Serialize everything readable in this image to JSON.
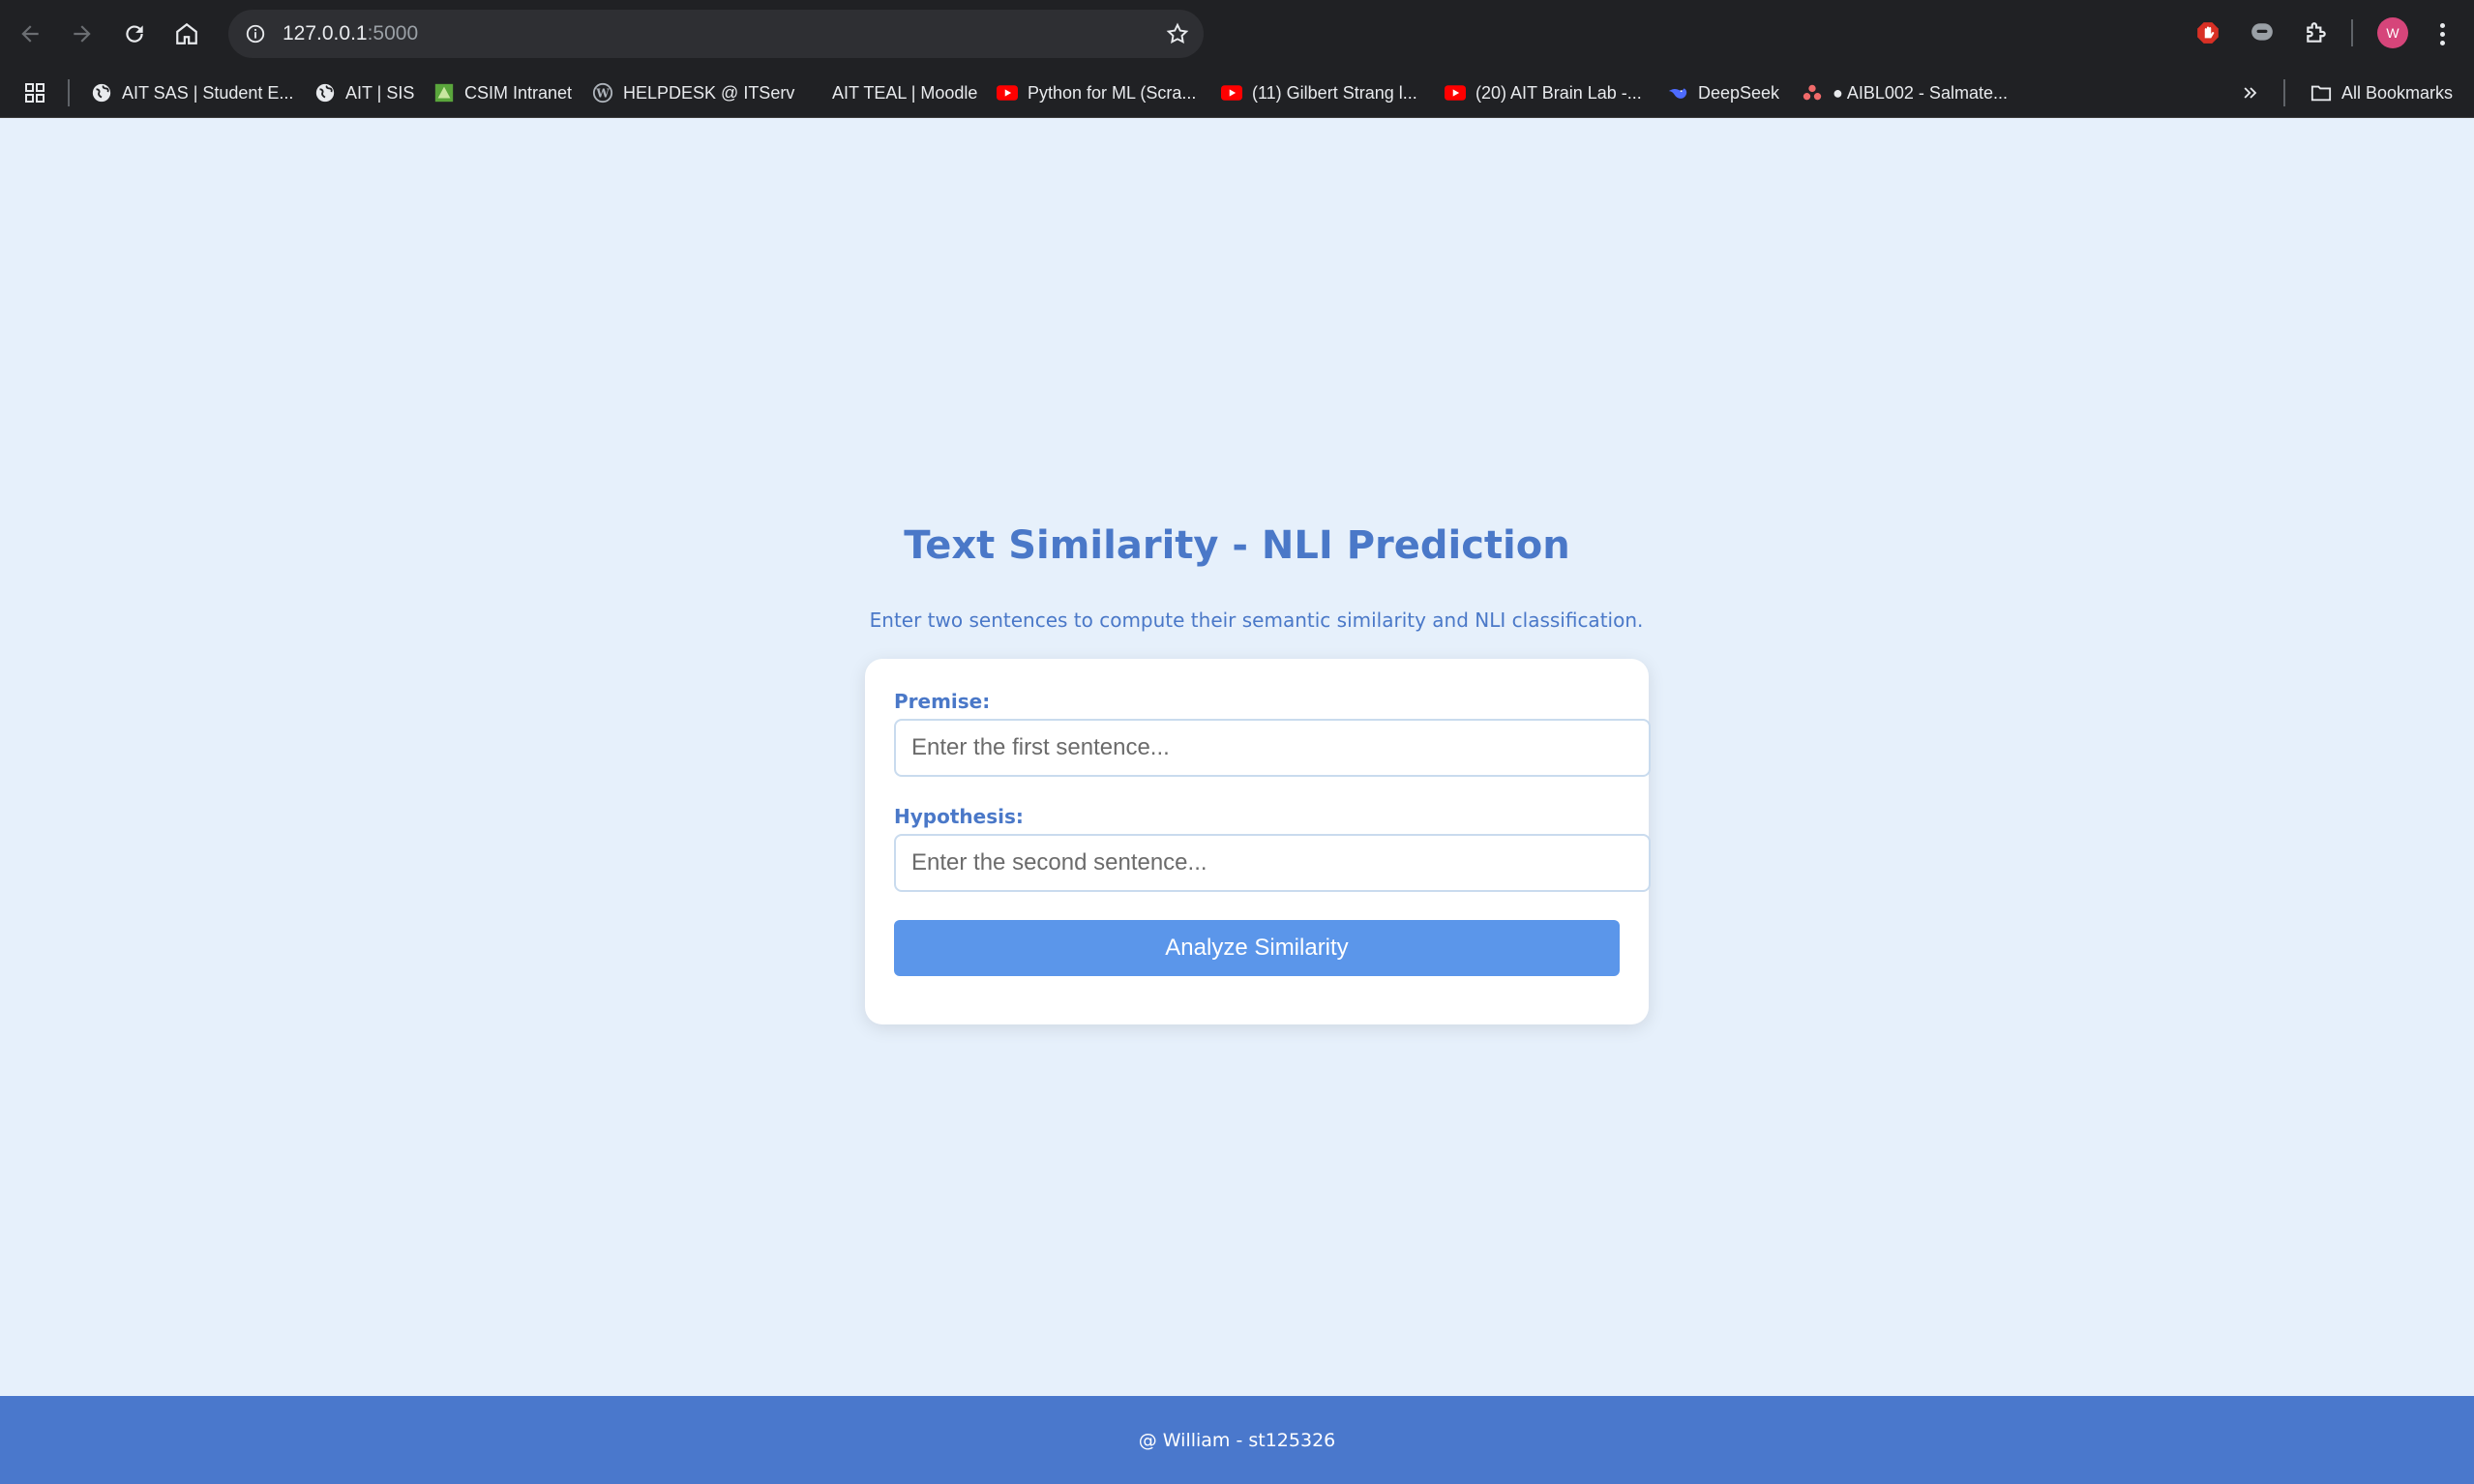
{
  "browser": {
    "url_host": "127.0.0.1",
    "url_port": ":5000",
    "avatar_letter": "W",
    "bookmarks": [
      {
        "label": "AIT SAS | Student E...",
        "icon": "globe-icon"
      },
      {
        "label": "AIT | SIS",
        "icon": "globe-icon"
      },
      {
        "label": "CSIM Intranet",
        "icon": "csim-icon"
      },
      {
        "label": "HELPDESK @ ITServ",
        "icon": "wordpress-icon"
      },
      {
        "label": "AIT TEAL | Moodle",
        "icon": "none"
      },
      {
        "label": "Python for ML (Scra...",
        "icon": "youtube-icon"
      },
      {
        "label": "(11) Gilbert Strang l...",
        "icon": "youtube-icon"
      },
      {
        "label": "(20) AIT Brain Lab -...",
        "icon": "youtube-icon"
      },
      {
        "label": "DeepSeek",
        "icon": "deepseek-icon"
      },
      {
        "label": "● AIBL002 - Salmate...",
        "icon": "asana-icon"
      }
    ],
    "all_bookmarks_label": "All Bookmarks"
  },
  "page": {
    "title": "Text Similarity - NLI Prediction",
    "subtitle": "Enter two sentences to compute their semantic similarity and NLI classification.",
    "form": {
      "premise_label": "Premise:",
      "premise_placeholder": "Enter the first sentence...",
      "premise_value": "",
      "hypothesis_label": "Hypothesis:",
      "hypothesis_placeholder": "Enter the second sentence...",
      "hypothesis_value": "",
      "submit_label": "Analyze Similarity"
    },
    "footer": "@ William - st125326"
  },
  "colors": {
    "accent": "#4a78c8",
    "button": "#5b96ea",
    "background": "#e6f0fb",
    "footer": "#4a78cc"
  }
}
